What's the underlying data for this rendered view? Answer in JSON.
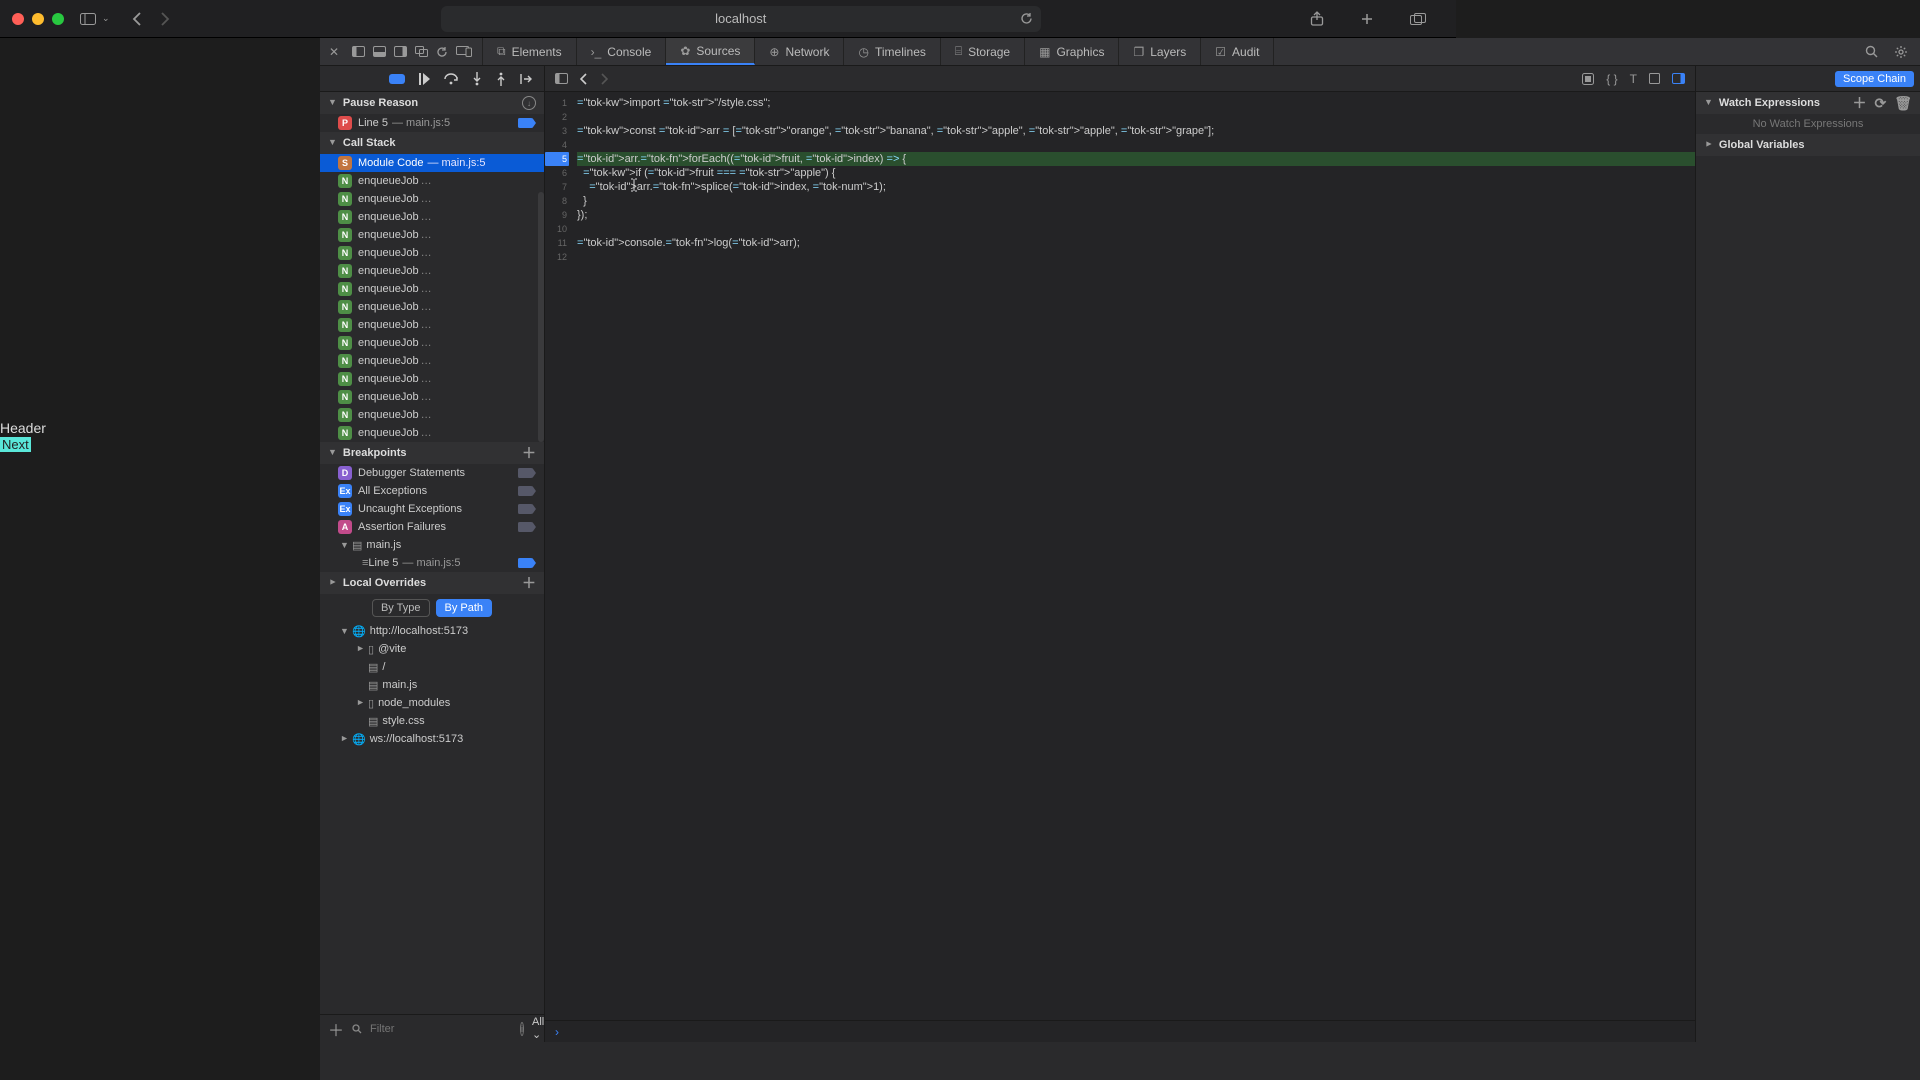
{
  "window": {
    "url": "localhost"
  },
  "page_preview": {
    "header": "Header",
    "next": "Next"
  },
  "devtools": {
    "tabs": [
      "Elements",
      "Console",
      "Sources",
      "Network",
      "Timelines",
      "Storage",
      "Graphics",
      "Layers",
      "Audit"
    ],
    "active_tab": "Sources"
  },
  "left": {
    "pause_reason": {
      "title": "Pause Reason",
      "item_label": "Line 5",
      "item_sub": "main.js:5"
    },
    "call_stack": {
      "title": "Call Stack",
      "top_label": "Module Code",
      "top_sub": "main.js:5",
      "rest_label": "enqueueJob"
    },
    "breakpoints": {
      "title": "Breakpoints",
      "rows": [
        {
          "badge": "D",
          "label": "Debugger Statements"
        },
        {
          "badge": "Ex",
          "label": "All Exceptions"
        },
        {
          "badge": "Ex",
          "label": "Uncaught Exceptions"
        },
        {
          "badge": "A",
          "label": "Assertion Failures"
        }
      ],
      "file": "main.js",
      "bp_label": "Line 5",
      "bp_sub": "main.js:5"
    },
    "local_overrides": {
      "title": "Local Overrides",
      "by_type": "By Type",
      "by_path": "By Path"
    },
    "tree": {
      "root": "http://localhost:5173",
      "vite": "@vite",
      "slash": "/",
      "main": "main.js",
      "node": "node_modules",
      "style": "style.css",
      "ws": "ws://localhost:5173"
    },
    "filter": {
      "placeholder": "Filter",
      "all": "All"
    }
  },
  "editor": {
    "lines": [
      "import \"/style.css\";",
      "",
      "const arr = [\"orange\", \"banana\", \"apple\", \"apple\", \"grape\"];",
      "",
      "arr.forEach((fruit, index) => {",
      "  if (fruit === \"apple\") {",
      "    arr.splice(index, 1);",
      "  }",
      "});",
      "",
      "console.log(arr);",
      ""
    ],
    "bp_line": 5,
    "highlight_line": 5
  },
  "right": {
    "scope_chain": "Scope Chain",
    "watch": {
      "title": "Watch Expressions",
      "empty": "No Watch Expressions"
    },
    "globals": "Global Variables"
  }
}
